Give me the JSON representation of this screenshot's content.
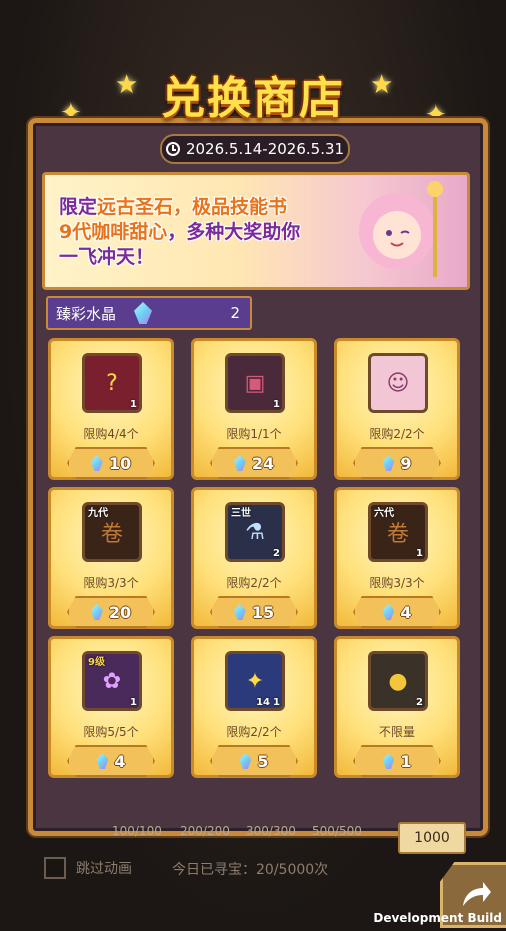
{
  "title": "兑换商店",
  "date_range": "2026.5.14-2026.5.31",
  "banner": {
    "line1_pre": "限定",
    "line1_hl": "远古圣石，极品技能书",
    "line2_hl": "9代咖啡甜心",
    "line2_post": "，多种大奖助你",
    "line3": "一飞冲天！"
  },
  "currency": {
    "name": "臻彩水晶",
    "amount": "2"
  },
  "items": [
    {
      "icon": "treasure-chest-icon",
      "limit": "限购4/4个",
      "price": "10",
      "count": "1"
    },
    {
      "icon": "backpack-icon",
      "limit": "限购1/1个",
      "price": "24",
      "count": "1"
    },
    {
      "icon": "character-portrait-icon",
      "limit": "限购2/2个",
      "price": "9",
      "count": ""
    },
    {
      "icon": "myth-scroll-icon",
      "tag": "九代",
      "limit": "限购3/3个",
      "price": "20",
      "count": ""
    },
    {
      "icon": "potion-bottle-icon",
      "tag": "三世",
      "limit": "限购2/2个",
      "price": "15",
      "count": "2"
    },
    {
      "icon": "myth-scroll-icon",
      "tag": "六代",
      "limit": "限购3/3个",
      "price": "4",
      "count": "1"
    },
    {
      "icon": "skill-book-icon",
      "tag": "9级",
      "limit": "限购5/5个",
      "price": "4",
      "count": "1"
    },
    {
      "icon": "ticket-icon",
      "tag": "14",
      "limit": "限购2/2个",
      "price": "5",
      "count": "1"
    },
    {
      "icon": "gold-coin-bag-icon",
      "limit": "不限量",
      "price": "1",
      "count": "2"
    }
  ],
  "bottom": {
    "tiers": [
      "100/100",
      "200/200",
      "300/300",
      "500/500"
    ],
    "button": "1000",
    "skip_label": "跳过动画",
    "progress": "今日已寻宝：20/5000次"
  },
  "dev_build": "Development Build",
  "colors": {
    "accent": "#ffe14a",
    "frame": "#c88a3a",
    "card": "#ffe07a"
  }
}
